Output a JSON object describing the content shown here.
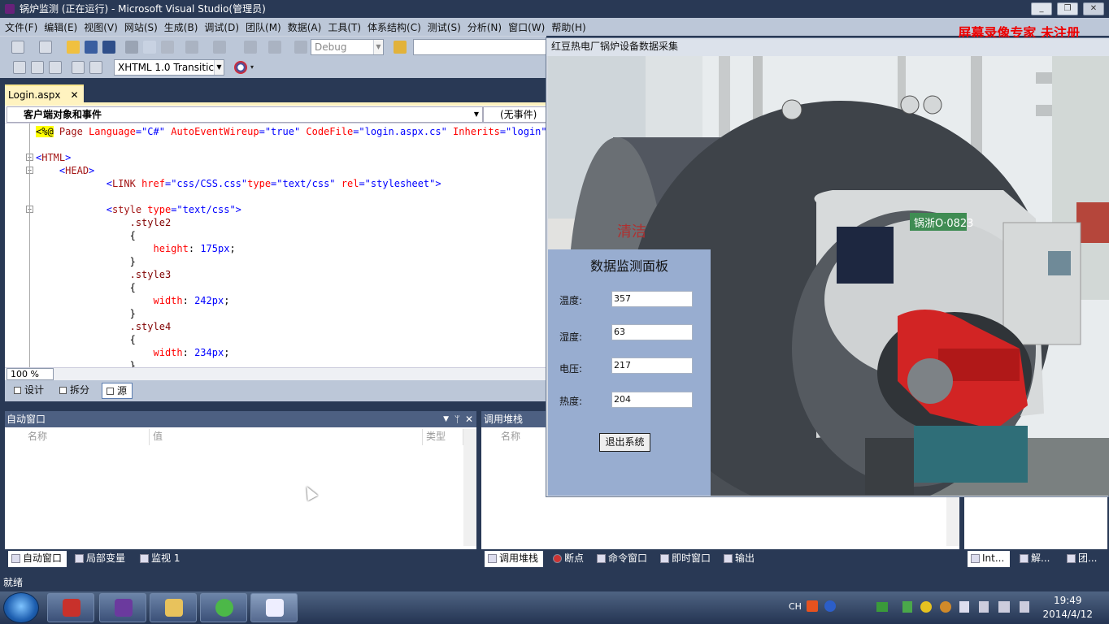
{
  "window": {
    "title": "锅炉监测 (正在运行) - Microsoft Visual Studio(管理员)"
  },
  "menu": [
    "文件(F)",
    "编辑(E)",
    "视图(V)",
    "网站(S)",
    "生成(B)",
    "调试(D)",
    "团队(M)",
    "数据(A)",
    "工具(T)",
    "体系结构(C)",
    "测试(S)",
    "分析(N)",
    "窗口(W)",
    "帮助(H)"
  ],
  "watermark": "屏幕录像专家 未注册",
  "toolbar": {
    "config": "Debug",
    "doctype": "XHTML 1.0 Transitic"
  },
  "editor": {
    "tab": "Login.aspx",
    "nav_left": "客户端对象和事件",
    "nav_right": "(无事件)",
    "zoom": "100 %",
    "lines": [
      "<%@ Page Language=\"C#\" AutoEventWireup=\"true\" CodeFile=\"login.aspx.cs\" Inherits=\"login\" %>",
      "",
      "<HTML>",
      "    <HEAD>",
      "            <LINK href=\"css/CSS.css\"type=\"text/css\" rel=\"stylesheet\">",
      "",
      "            <style type=\"text/css\">",
      "                .style2",
      "                {",
      "                    height: 175px;",
      "                }",
      "                .style3",
      "                {",
      "                    width: 242px;",
      "                }",
      "                .style4",
      "                {",
      "                    width: 234px;",
      "                }"
    ],
    "views": [
      "设计",
      "拆分",
      "源"
    ]
  },
  "autos": {
    "title": "自动窗口",
    "columns": [
      "名称",
      "值",
      "类型"
    ]
  },
  "callstack": {
    "title": "调用堆栈",
    "columns": [
      "名称"
    ]
  },
  "bottom_tabs_left": [
    "自动窗口",
    "局部变量",
    "监视 1"
  ],
  "bottom_tabs_mid": [
    "调用堆栈",
    "断点",
    "命令窗口",
    "即时窗口",
    "输出"
  ],
  "bottom_tabs_right": [
    "Int...",
    "解...",
    "团..."
  ],
  "status": "就绪",
  "app": {
    "title": "红豆热电厂锅炉设备数据采集",
    "panel_title": "数据监测面板",
    "fields": [
      {
        "label": "温度:",
        "value": "357"
      },
      {
        "label": "湿度:",
        "value": "63"
      },
      {
        "label": "电压:",
        "value": "217"
      },
      {
        "label": "热度:",
        "value": "204"
      }
    ],
    "exit_button": "退出系统",
    "photo_text": {
      "plate": "锅浙O·0823",
      "sign": "清洁"
    }
  },
  "taskbar": {
    "lang": "CH",
    "time": "19:49",
    "date": "2014/4/12"
  }
}
